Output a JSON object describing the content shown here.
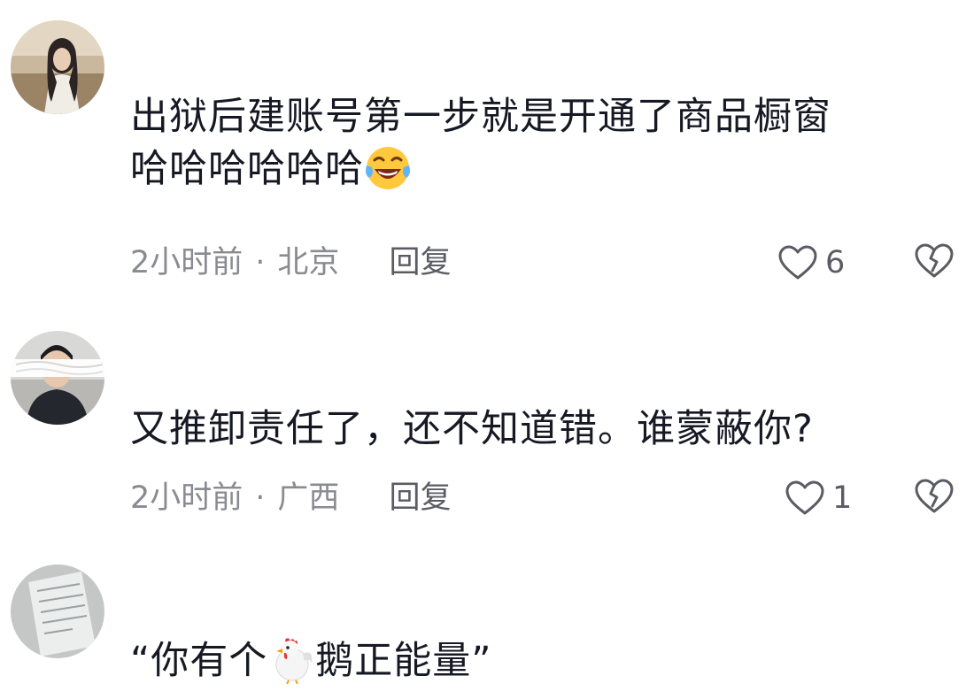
{
  "comments": [
    {
      "text_line1": "出狱后建账号第一步就是开通了商品橱窗",
      "text_line2": "哈哈哈哈哈哈",
      "emoji": "laughing-tears-icon",
      "time": "2小时前",
      "separator": "·",
      "location": "北京",
      "reply_label": "回复",
      "like_count": "6"
    },
    {
      "text_line1": "又推卸责任了，还不知道错。谁蒙蔽你?",
      "time": "2小时前",
      "separator": "·",
      "location": "广西",
      "reply_label": "回复",
      "like_count": "1"
    },
    {
      "text_before_emoji": "“你有个",
      "text_after_emoji": "鹅正能量”",
      "emoji": "rooster-icon"
    }
  ],
  "icons": {
    "like": "heart-outline-icon",
    "dislike": "broken-heart-icon"
  },
  "colors": {
    "text": "#161823",
    "meta": "#8a8b91",
    "action": "#5b5c63"
  }
}
